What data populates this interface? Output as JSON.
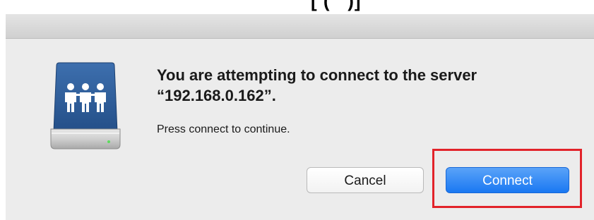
{
  "top_fragment_text": "[ (   )]",
  "dialog": {
    "title": "You are attempting to connect to the server “192.168.0.162”.",
    "body": "Press connect to continue.",
    "cancel_label": "Cancel",
    "connect_label": "Connect"
  },
  "icons": {
    "app_icon": "network-server-drive-icon",
    "people_glyph": "group-people-icon"
  },
  "colors": {
    "highlight": "#e2232a",
    "primary_button": "#1a78f2",
    "dialog_bg": "#ececec",
    "icon_blue": "#2f5e9e"
  }
}
